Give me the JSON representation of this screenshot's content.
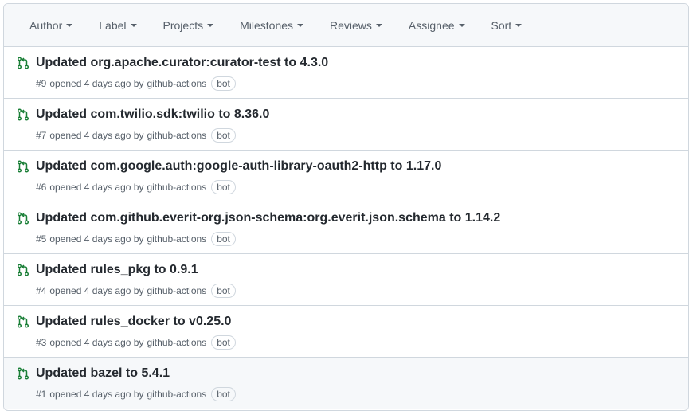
{
  "filters": [
    {
      "label": "Author"
    },
    {
      "label": "Label"
    },
    {
      "label": "Projects"
    },
    {
      "label": "Milestones"
    },
    {
      "label": "Reviews"
    },
    {
      "label": "Assignee"
    },
    {
      "label": "Sort"
    }
  ],
  "pulls": [
    {
      "title": "Updated org.apache.curator:curator-test to 4.3.0",
      "number": "#9",
      "opened": "opened 4 days ago by",
      "author": "github-actions",
      "badge": "bot"
    },
    {
      "title": "Updated com.twilio.sdk:twilio to 8.36.0",
      "number": "#7",
      "opened": "opened 4 days ago by",
      "author": "github-actions",
      "badge": "bot"
    },
    {
      "title": "Updated com.google.auth:google-auth-library-oauth2-http to 1.17.0",
      "number": "#6",
      "opened": "opened 4 days ago by",
      "author": "github-actions",
      "badge": "bot"
    },
    {
      "title": "Updated com.github.everit-org.json-schema:org.everit.json.schema to 1.14.2",
      "number": "#5",
      "opened": "opened 4 days ago by",
      "author": "github-actions",
      "badge": "bot"
    },
    {
      "title": "Updated rules_pkg to 0.9.1",
      "number": "#4",
      "opened": "opened 4 days ago by",
      "author": "github-actions",
      "badge": "bot"
    },
    {
      "title": "Updated rules_docker to v0.25.0",
      "number": "#3",
      "opened": "opened 4 days ago by",
      "author": "github-actions",
      "badge": "bot"
    },
    {
      "title": "Updated bazel to 5.4.1",
      "number": "#1",
      "opened": "opened 4 days ago by",
      "author": "github-actions",
      "badge": "bot"
    }
  ],
  "colors": {
    "open_pr_icon": "#1a7f37",
    "hover_row": "#f6f8fa"
  }
}
